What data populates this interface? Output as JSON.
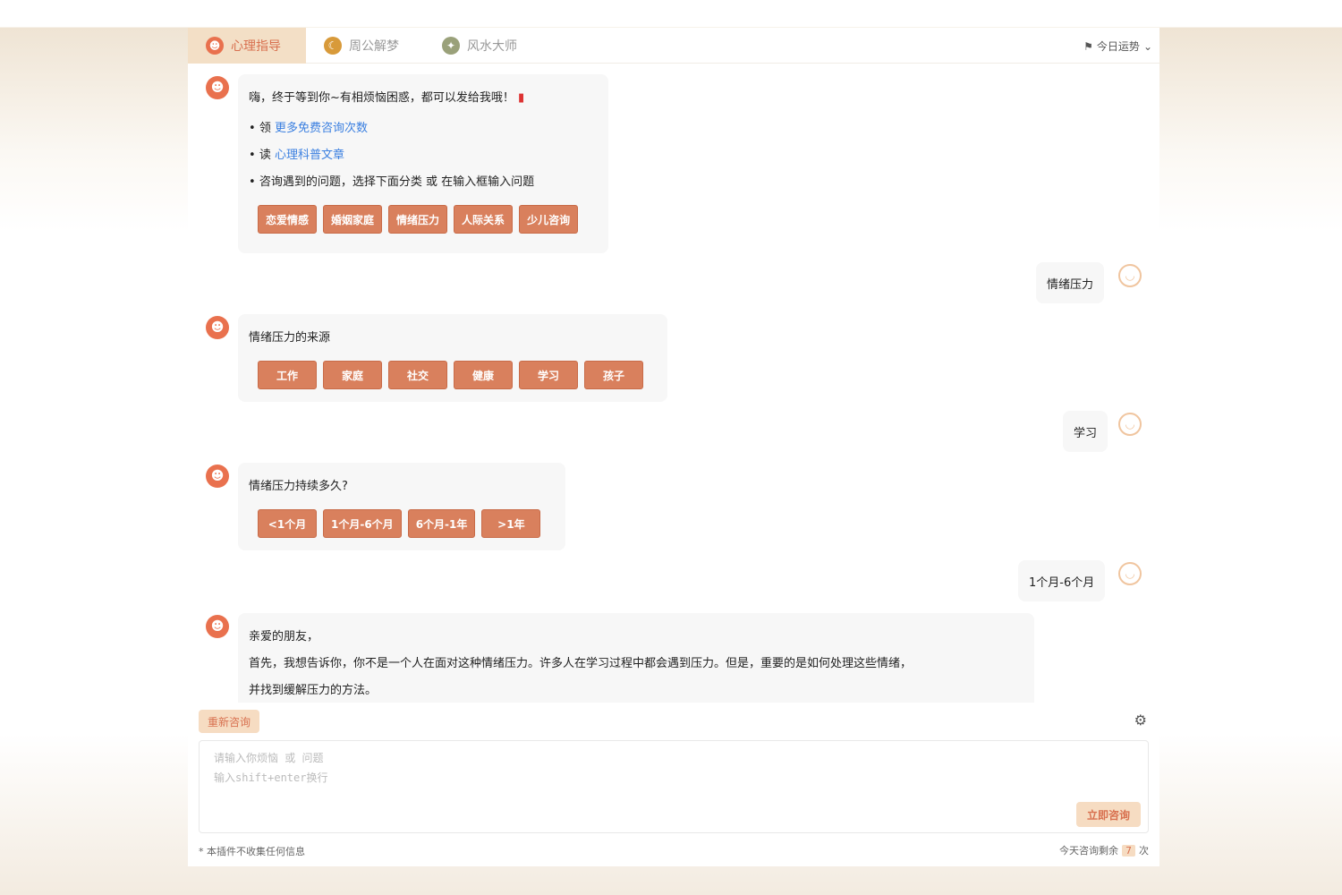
{
  "tabs": [
    {
      "label": "心理指导",
      "icon": "heart-face-icon",
      "color": "#e9714e"
    },
    {
      "label": "周公解梦",
      "icon": "moon-icon",
      "color": "#d89a3a"
    },
    {
      "label": "风水大师",
      "icon": "compass-icon",
      "color": "#9aa17a"
    }
  ],
  "top_right": {
    "label": "今日运势",
    "icon": "pin-icon"
  },
  "messages": {
    "welcome": {
      "text": "嗨，终于等到你~有相烦恼困惑，都可以发给我哦！",
      "items": [
        {
          "prefix": "领",
          "link": "更多免费咨询次数"
        },
        {
          "prefix": "读",
          "link": "心理科普文章"
        },
        {
          "prefix": "",
          "text": "咨询遇到的问题，选择下面分类 或 在输入框输入问题"
        }
      ],
      "options": [
        "恋爱情感",
        "婚姻家庭",
        "情绪压力",
        "人际关系",
        "少儿咨询"
      ]
    },
    "user1": "情绪压力",
    "bot2": {
      "text": "情绪压力的来源",
      "options": [
        "工作",
        "家庭",
        "社交",
        "健康",
        "学习",
        "孩子"
      ]
    },
    "user2": "学习",
    "bot3": {
      "text": "情绪压力持续多久?",
      "options": [
        "<1个月",
        "1个月-6个月",
        "6个月-1年",
        ">1年"
      ]
    },
    "user3": "1个月-6个月",
    "bot4": {
      "lines": [
        "亲爱的朋友，",
        "首先，我想告诉你，你不是一个人在面对这种情绪压力。许多人在学习过程中都会遇到压力。但是，重要的是如何处理这些情绪，",
        "并找到缓解压力的方法。"
      ]
    }
  },
  "controls": {
    "restart_label": "重新咨询",
    "input_placeholder": "请输入你烦恼 或 问题\n输入shift+enter换行",
    "send_label": "立即咨询"
  },
  "footer": {
    "left": "* 本插件不收集任何信息",
    "right_label": "今天咨询剩余",
    "remaining": "7",
    "unit": "次"
  }
}
